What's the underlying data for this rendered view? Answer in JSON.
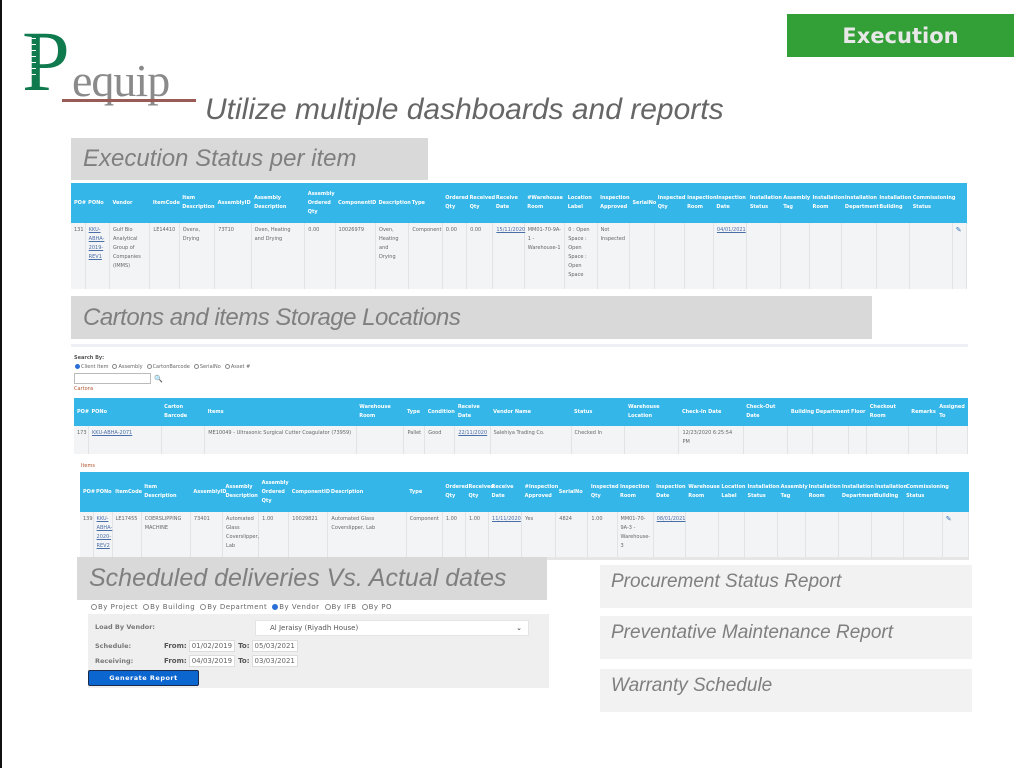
{
  "brand": {
    "logo_initial": "P",
    "logo_rest": "equip",
    "badge_label": "Execution",
    "badge_color": "#33a037"
  },
  "main_title": "Utilize multiple dashboards and reports",
  "sections": {
    "execution_title": "Execution Status per item",
    "storage_title": "Cartons and items Storage Locations",
    "schedule_title": "Scheduled deliveries Vs. Actual dates"
  },
  "execution_table": {
    "headers": [
      "PO#",
      "PONo",
      "Vendor",
      "ItemCode",
      "Item Description",
      "AssemblyID",
      "Assembly Description",
      "Assembly Ordered Qty",
      "ComponentID",
      "Description",
      "Type",
      "Ordered Qty",
      "Received Qty",
      "Receive Date",
      "#Warehouse Room",
      "Location Label",
      "Inspection Approved",
      "SerialNo",
      "Inspected Qty",
      "Inspection Room",
      "Inspection Date",
      "Installation Status",
      "Assembly Tag",
      "Installation Room",
      "Installation Department",
      "Installation Building",
      "Commissioning Status",
      ""
    ],
    "rows": [
      [
        "131",
        "KKU-ABHA-2019-REV1",
        "Gulf Bio Analytical Group of Companies (IMMS)",
        "LE14410",
        "Ovens, Drying",
        "73T10",
        "Oven, Heating and Drying",
        "0.00",
        "10026979",
        "Oven, Heating and Drying",
        "Component",
        "0.00",
        "0.00",
        "15/11/2020",
        "MM01-70-9A-1 - Warehouse-1",
        "0 : Open Space : Open Space : Open Space",
        "Not Inspected",
        "",
        "",
        "",
        "04/01/2021",
        "",
        "",
        "",
        "",
        "",
        "",
        ""
      ]
    ]
  },
  "storage_search": {
    "label": "Search By:",
    "options": [
      "Client Item",
      "Assembly",
      "CartonBarcode",
      "SerialNo",
      "Asset #"
    ],
    "selected": "Client Item",
    "input_value": "",
    "cartons_label": "Cartons",
    "items_label": "Items"
  },
  "cartons_table": {
    "headers": [
      "PO#",
      "PONo",
      "Carton Barcode",
      "Items",
      "Warehouse Room",
      "Type",
      "Condition",
      "Receive Date",
      "Vendor Name",
      "Status",
      "Warehouse Location",
      "Check-In Date",
      "Check-Out Date",
      "Building",
      "Department",
      "Floor",
      "Checkout Room",
      "Remarks",
      "Assigned To"
    ],
    "rows": [
      [
        "173",
        "KKU-ABHA-2071",
        "",
        "ME10049 - Ultrasonic Surgical Cutter Coagulator (73959)",
        "",
        "Pallet",
        "Good",
        "22/11/2020",
        "Salehiya Trading Co.",
        "Checked In",
        "",
        "12/23/2020 6:25:54 PM",
        "",
        "",
        "",
        "",
        "",
        "",
        ""
      ]
    ]
  },
  "items_table": {
    "headers": [
      "PO#",
      "PONo",
      "ItemCode",
      "Item Description",
      "AssemblyID",
      "Assembly Description",
      "Assembly Ordered Qty",
      "ComponentID",
      "Description",
      "Type",
      "Ordered Qty",
      "Received Qty",
      "Receive Date",
      "#Inspection Approved",
      "SerialNo",
      "Inspected Qty",
      "Inspection Room",
      "Inspection Date",
      "Warehouse Room",
      "Location Label",
      "Installation Status",
      "Assembly Tag",
      "Installation Room",
      "Installation Department",
      "Installation Building",
      "Commissioning Status",
      ""
    ],
    "rows": [
      [
        "139",
        "KKU-ABHA-2020-REV2",
        "LE17455",
        "COERSLIPPING MACHINE",
        "73401",
        "Automated Glass Coverslipper, Lab",
        "1.00",
        "10029821",
        "Automated Glass Coverslipper, Lab",
        "Component",
        "1.00",
        "1.00",
        "11/11/2020",
        "Yes",
        "4824",
        "1.00",
        "MM01-70-9A-3 - Warehouse-3",
        "08/01/2021",
        "",
        "",
        "",
        "",
        "",
        "",
        "",
        "",
        ""
      ]
    ]
  },
  "schedule_form": {
    "radio_options": [
      "By Project",
      "By Building",
      "By Department",
      "By Vendor",
      "By IFB",
      "By PO"
    ],
    "selected": "By Vendor",
    "vendor_label": "Load By Vendor:",
    "vendor_value": "Al Jeraisy (Riyadh House)",
    "schedule_label": "Schedule:",
    "receiving_label": "Receiving:",
    "from_label": "From:",
    "to_label": "To:",
    "schedule_from": "01/02/2019",
    "schedule_to": "05/03/2021",
    "receiving_from": "04/03/2019",
    "receiving_to": "03/03/2021",
    "generate_label": "Generate Report"
  },
  "reports": [
    "Procurement Status Report",
    "Preventative Maintenance Report",
    "Warranty Schedule"
  ]
}
